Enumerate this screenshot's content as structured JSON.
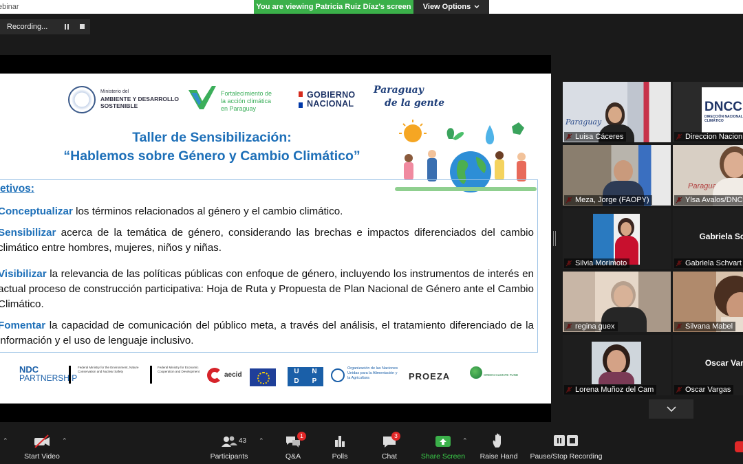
{
  "window": {
    "title": "ebinar"
  },
  "banner": {
    "viewing": "You are viewing Patricia Ruiz Díaz's screen",
    "view_options": "View Options"
  },
  "recording": {
    "label": "Recording..."
  },
  "slide": {
    "logos": {
      "ministry_small": "Ministerio del",
      "ministry_main": "AMBIENTE Y DESARROLLO",
      "ministry_main2": "SOSTENIBLE",
      "fort_1": "Fortalecimiento de",
      "fort_2": "la acción climática",
      "fort_3": "en Paraguay",
      "gob_1": "GOBIERNO",
      "gob_2": "NACIONAL",
      "pya_1": "Paraguay",
      "pya_2": "de la gente"
    },
    "title_1": "Taller de Sensibilización:",
    "title_2": "“Hablemos sobre Género y Cambio Climático”",
    "objectives_head": "etivos:",
    "objectives": [
      {
        "kw": "Conceptualizar",
        "text": " los términos relacionados al género y el cambio climático."
      },
      {
        "kw": "Sensibilizar",
        "text": " acerca de la temática de género, considerando las brechas e impactos diferenciados del cambio climático entre hombres, mujeres, niños y niñas."
      },
      {
        "kw": "Visibilizar",
        "text": " la relevancia de las políticas públicas con enfoque de género, incluyendo los instrumentos de interés en actual proceso de construcción participativa: Hoja de Ruta y Propuesta de Plan Nacional de Género ante el Cambio Climático."
      },
      {
        "kw": "Fomentar",
        "text": " la capacidad de comunicación del público meta, a través del análisis, el tratamiento diferenciado de la información y el uso de lenguaje inclusivo."
      }
    ],
    "sponsors": {
      "ndc_1": "NDC",
      "ndc_2": "PARTNERSHIP",
      "bmu": "Federal Ministry for the Environment, Nature Conservation and Nuclear Safety",
      "bmz": "Federal Ministry for Economic Cooperation and Development",
      "aecid": "aecid",
      "undp_1": "U",
      "undp_2": "N",
      "undp_3": "D",
      "undp_4": "P",
      "fao": "Organización de las Naciones Unidas para la Alimentación y la Agricultura",
      "proeza": "PROEZA",
      "gcf": "GREEN CLIMATE FUND"
    }
  },
  "participants_gallery": [
    {
      "name": "Luisa Cáceres"
    },
    {
      "name": "Direccion Nacion"
    },
    {
      "name": "Meza, Jorge (FAOPY)"
    },
    {
      "name": "Ylsa Avalos/DNCC/"
    },
    {
      "name": "Silvia Morimoto"
    },
    {
      "name": "Gabriela Schvart",
      "big": "Gabriela  Schv"
    },
    {
      "name": "regina guex"
    },
    {
      "name": "Silvana Mabel"
    },
    {
      "name": "Lorena Muñoz del Cam"
    },
    {
      "name": "Oscar Vargas",
      "big": "Oscar Varg"
    }
  ],
  "tile_texts": {
    "dncc": "DNCC",
    "dncc_sub": "DIRECCIÓN NACIONAL DE CAMBIO CLIMÁTICO",
    "paraguay": "Paraguay"
  },
  "toolbar": {
    "start_video": "Start Video",
    "participants": "Participants",
    "participants_count": "43",
    "qa": "Q&A",
    "qa_badge": "1",
    "polls": "Polls",
    "chat": "Chat",
    "chat_badge": "3",
    "share_screen": "Share Screen",
    "raise_hand": "Raise Hand",
    "pause_stop_recording": "Pause/Stop Recording"
  },
  "colors": {
    "share_green": "#3bb04a",
    "accent_blue": "#1d6fb8",
    "muted_red": "#e02828",
    "active_yellow": "#f4d33a"
  }
}
